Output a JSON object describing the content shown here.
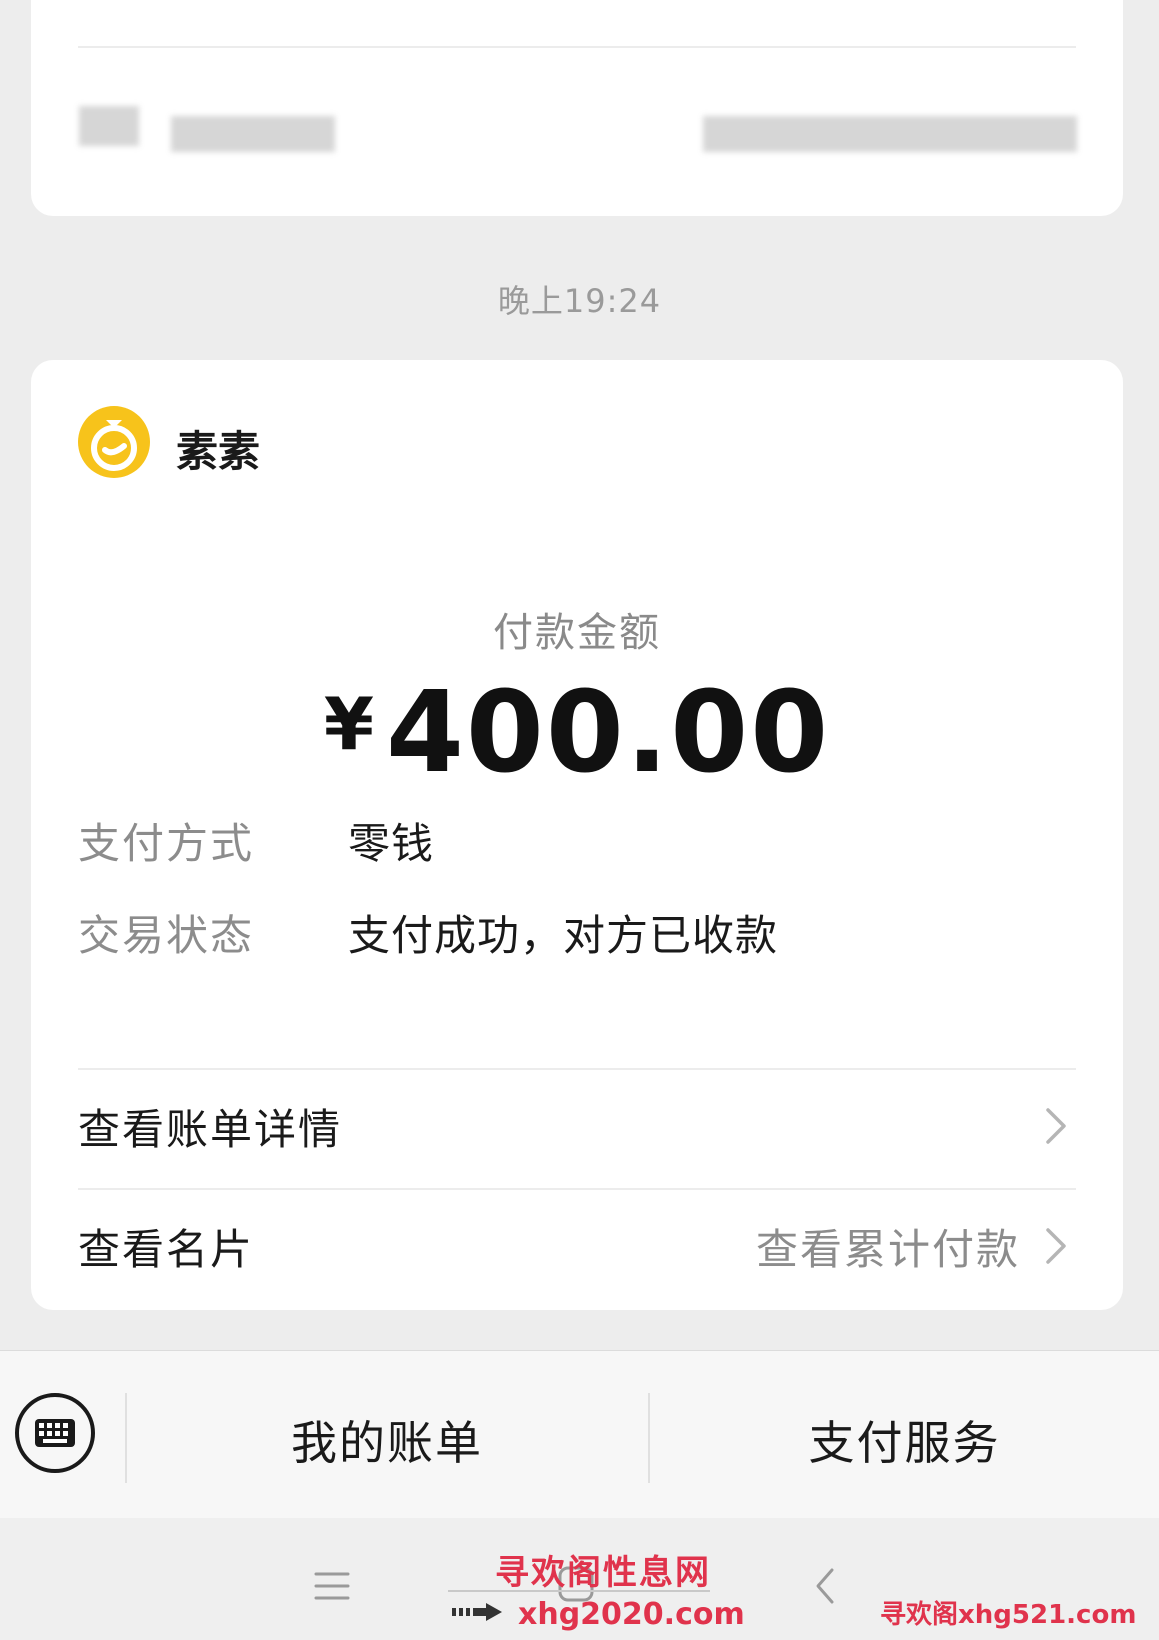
{
  "timestamp": "晚上19:24",
  "payment_card": {
    "merchant_name": "素素",
    "amount_label": "付款金额",
    "currency_symbol": "¥",
    "amount": "400.00",
    "rows": [
      {
        "label": "支付方式",
        "value": "零钱"
      },
      {
        "label": "交易状态",
        "value": "支付成功，对方已收款"
      }
    ],
    "links": [
      {
        "label": "查看账单详情",
        "right_text": ""
      },
      {
        "label": "查看名片",
        "right_text": "查看累计付款"
      }
    ]
  },
  "bottom_menu": {
    "tabs": [
      "我的账单",
      "支付服务"
    ]
  },
  "watermark": {
    "title": "寻欢阁性息网",
    "url": "xhg2020.com",
    "corner": "寻欢阁xhg521.com"
  },
  "colors": {
    "background": "#ededed",
    "card": "#ffffff",
    "merchant_logo": "#f7c31b",
    "watermark": "#e0334c"
  },
  "icons": {
    "merchant": "wechat-pay-coin-bag-icon",
    "keyboard": "keyboard-icon",
    "link_arrow": "chevron-right-icon",
    "nav": [
      "menu-icon",
      "home-icon",
      "back-icon"
    ]
  }
}
